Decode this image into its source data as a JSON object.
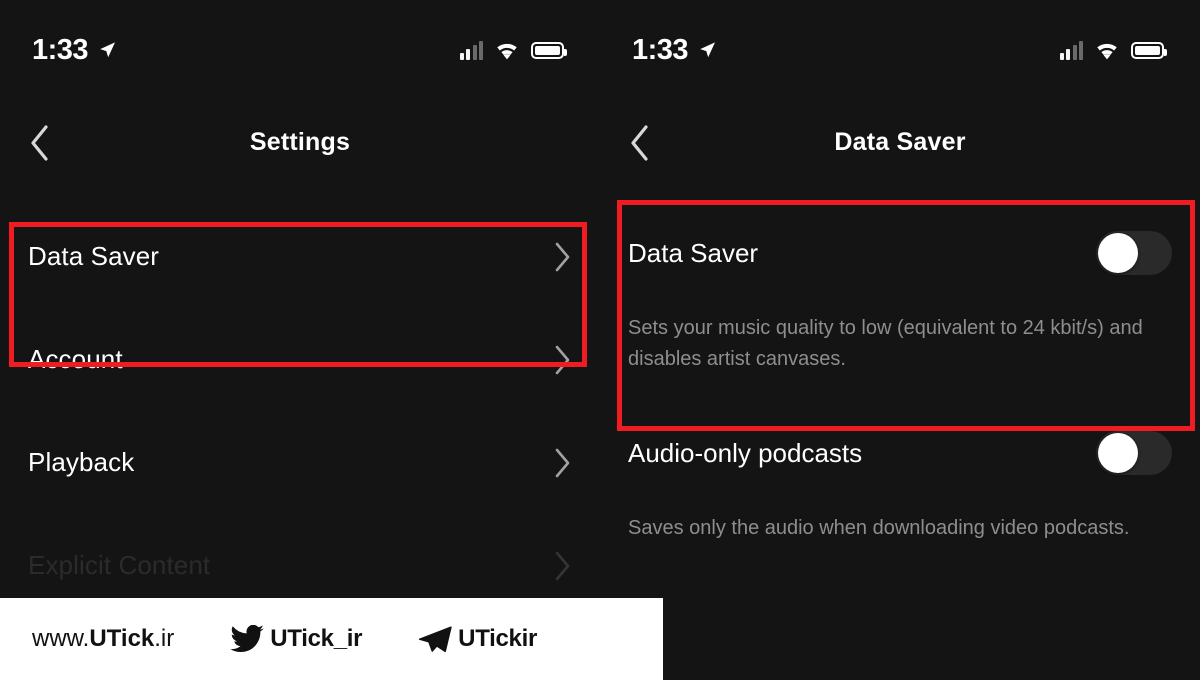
{
  "status_bar": {
    "time": "1:33",
    "location_icon": "location-arrow-icon",
    "cellular_icon": "cellular-signal-icon",
    "wifi_icon": "wifi-icon",
    "battery_icon": "battery-full-icon"
  },
  "left_screen": {
    "nav": {
      "back_icon": "chevron-left-icon",
      "title": "Settings"
    },
    "rows": [
      {
        "label": "Data Saver",
        "chevron": "chevron-right-icon",
        "highlighted": true
      },
      {
        "label": "Account",
        "chevron": "chevron-right-icon",
        "highlighted": false
      },
      {
        "label": "Playback",
        "chevron": "chevron-right-icon",
        "highlighted": false
      },
      {
        "label": "Explicit Content",
        "chevron": "chevron-right-icon",
        "highlighted": false
      }
    ]
  },
  "right_screen": {
    "nav": {
      "back_icon": "chevron-left-icon",
      "title": "Data Saver"
    },
    "settings": [
      {
        "label": "Data Saver",
        "toggle_state": "off",
        "description": "Sets your music quality to low (equivalent to 24 kbit/s) and disables artist canvases."
      },
      {
        "label": "Audio-only podcasts",
        "toggle_state": "off",
        "description": "Saves only the audio when downloading video podcasts."
      }
    ]
  },
  "annotations": {
    "highlight_color": "#f01c22",
    "left_box_target": "Data Saver",
    "right_box_target": "Data Saver toggle and description"
  },
  "watermark": {
    "website": "www.UTick.ir",
    "website_prefix": "www.",
    "website_brand": "UTick",
    "website_suffix": ".ir",
    "twitter_icon": "twitter-bird-icon",
    "twitter_handle": "UTick_ir",
    "telegram_icon": "telegram-plane-icon",
    "telegram_handle": "UTickir"
  }
}
